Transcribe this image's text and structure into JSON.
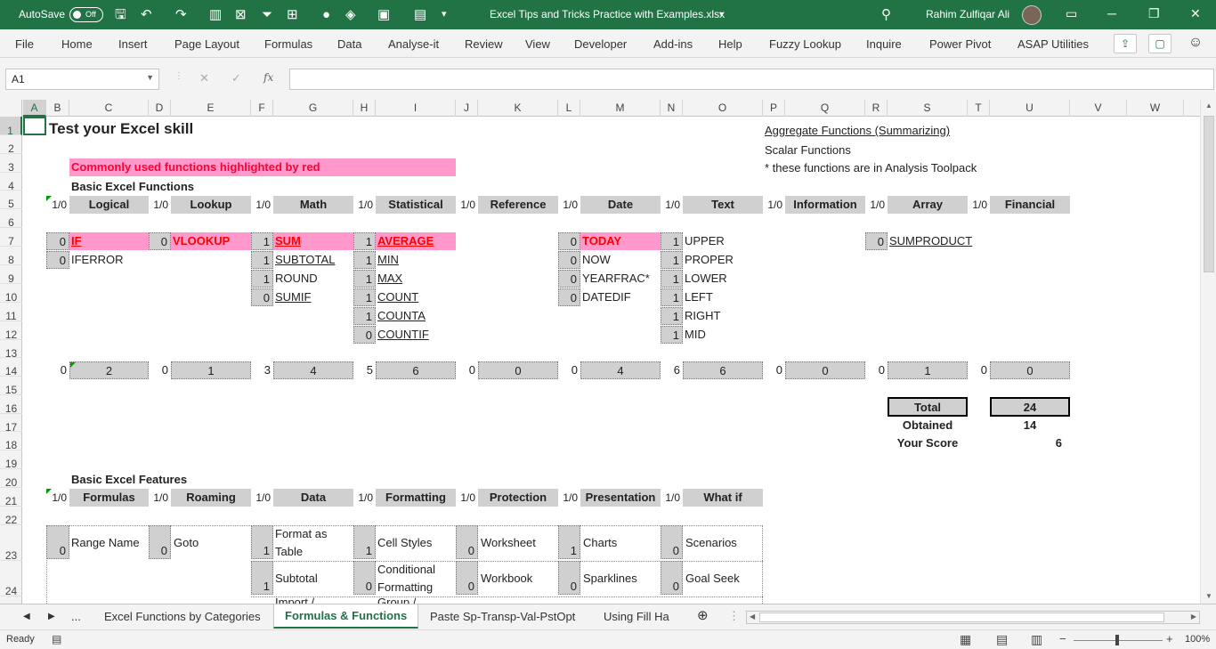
{
  "titlebar": {
    "autosave": "AutoSave",
    "toggle": "Off",
    "doc_title": "Excel Tips and Tricks Practice with Examples.xlsx",
    "user": "Rahim Zulfiqar Ali"
  },
  "ribbon": {
    "tabs": [
      "File",
      "Home",
      "Insert",
      "Page Layout",
      "Formulas",
      "Data",
      "Analyse-it",
      "Review",
      "View",
      "Developer",
      "Add-ins",
      "Help",
      "Fuzzy Lookup",
      "Inquire",
      "Power Pivot",
      "ASAP Utilities"
    ]
  },
  "formula_bar": {
    "name_box": "A1",
    "formula": ""
  },
  "columns": [
    "A",
    "B",
    "C",
    "D",
    "E",
    "F",
    "G",
    "H",
    "I",
    "J",
    "K",
    "L",
    "M",
    "N",
    "O",
    "P",
    "Q",
    "R",
    "S",
    "T",
    "U",
    "V",
    "W"
  ],
  "rows": [
    "1",
    "2",
    "3",
    "4",
    "5",
    "6",
    "7",
    "8",
    "9",
    "10",
    "11",
    "12",
    "13",
    "14",
    "15",
    "16",
    "17",
    "18",
    "19",
    "20",
    "21",
    "22",
    "23",
    "24"
  ],
  "sheet": {
    "title": "Test your Excel skill",
    "legend": [
      "Aggregate Functions (Summarizing)",
      "Scalar Functions",
      "* these functions are in Analysis Toolpack"
    ],
    "highlight_note": "Commonly used functions highlighted by red",
    "section1": "Basic Excel Functions",
    "ratio": "1/0",
    "categories": [
      "Logical",
      "Lookup",
      "Math",
      "Statistical",
      "Reference",
      "Date",
      "Text",
      "Information",
      "Array",
      "Financial"
    ],
    "logical": {
      "scores": [
        "0",
        "0"
      ],
      "items": [
        "IF",
        "IFERROR"
      ]
    },
    "lookup": {
      "scores": [
        "0"
      ],
      "items": [
        "VLOOKUP"
      ]
    },
    "math": {
      "scores": [
        "1",
        "1",
        "1",
        "0"
      ],
      "items": [
        "SUM",
        "SUBTOTAL",
        "ROUND",
        "SUMIF"
      ]
    },
    "statistical": {
      "scores": [
        "1",
        "1",
        "1",
        "1",
        "1",
        "0"
      ],
      "items": [
        "AVERAGE",
        "MIN",
        "MAX",
        "COUNT",
        "COUNTA",
        "COUNTIF"
      ]
    },
    "date": {
      "scores": [
        "0",
        "0",
        "0",
        "0"
      ],
      "items": [
        "TODAY",
        "NOW",
        "YEARFRAC*",
        "DATEDIF"
      ]
    },
    "text": {
      "scores": [
        "1",
        "1",
        "1",
        "1",
        "1",
        "1"
      ],
      "items": [
        "UPPER",
        "PROPER",
        "LOWER",
        "LEFT",
        "RIGHT",
        "MID"
      ]
    },
    "array": {
      "scores": [
        "0"
      ],
      "items": [
        "SUMPRODUCT"
      ]
    },
    "row14": {
      "obtained": [
        "0",
        "0",
        "3",
        "5",
        "0",
        "0",
        "6",
        "0",
        "0",
        "0"
      ],
      "totals": [
        "2",
        "1",
        "4",
        "6",
        "0",
        "4",
        "6",
        "0",
        "1",
        "0"
      ]
    },
    "total": {
      "label": "Total",
      "value": "24"
    },
    "obtained": {
      "label": "Obtained",
      "value": "14"
    },
    "score": {
      "label": "Your Score",
      "value": "6"
    },
    "section2": "Basic Excel Features",
    "features": [
      "Formulas",
      "Roaming",
      "Data",
      "Formatting",
      "Protection",
      "Presentation",
      "What if"
    ],
    "feature_items": {
      "formulas": {
        "items": [
          "Range Name"
        ],
        "scores": [
          "0"
        ]
      },
      "roaming": {
        "items": [
          "Goto"
        ],
        "scores": [
          "0"
        ]
      },
      "data": {
        "items": [
          "Format as Table",
          "Subtotal",
          "Import /"
        ],
        "scores": [
          "1",
          "1"
        ]
      },
      "formatting": {
        "items": [
          "Cell Styles",
          "Conditional Formatting",
          "Group /"
        ],
        "scores": [
          "1",
          "0"
        ]
      },
      "protection": {
        "items": [
          "Worksheet",
          "Workbook"
        ],
        "scores": [
          "0",
          "0"
        ]
      },
      "presentation": {
        "items": [
          "Charts",
          "Sparklines"
        ],
        "scores": [
          "1",
          "0"
        ]
      },
      "whatif": {
        "items": [
          "Scenarios",
          "Goal Seek"
        ],
        "scores": [
          "0",
          "0"
        ]
      }
    }
  },
  "sheets": {
    "more": "...",
    "tabs": [
      "Excel Functions by Categories",
      "Formulas & Functions",
      "Paste Sp-Transp-Val-PstOpt",
      "Using Fill Ha"
    ]
  },
  "status": {
    "ready": "Ready",
    "zoom": "100%"
  }
}
